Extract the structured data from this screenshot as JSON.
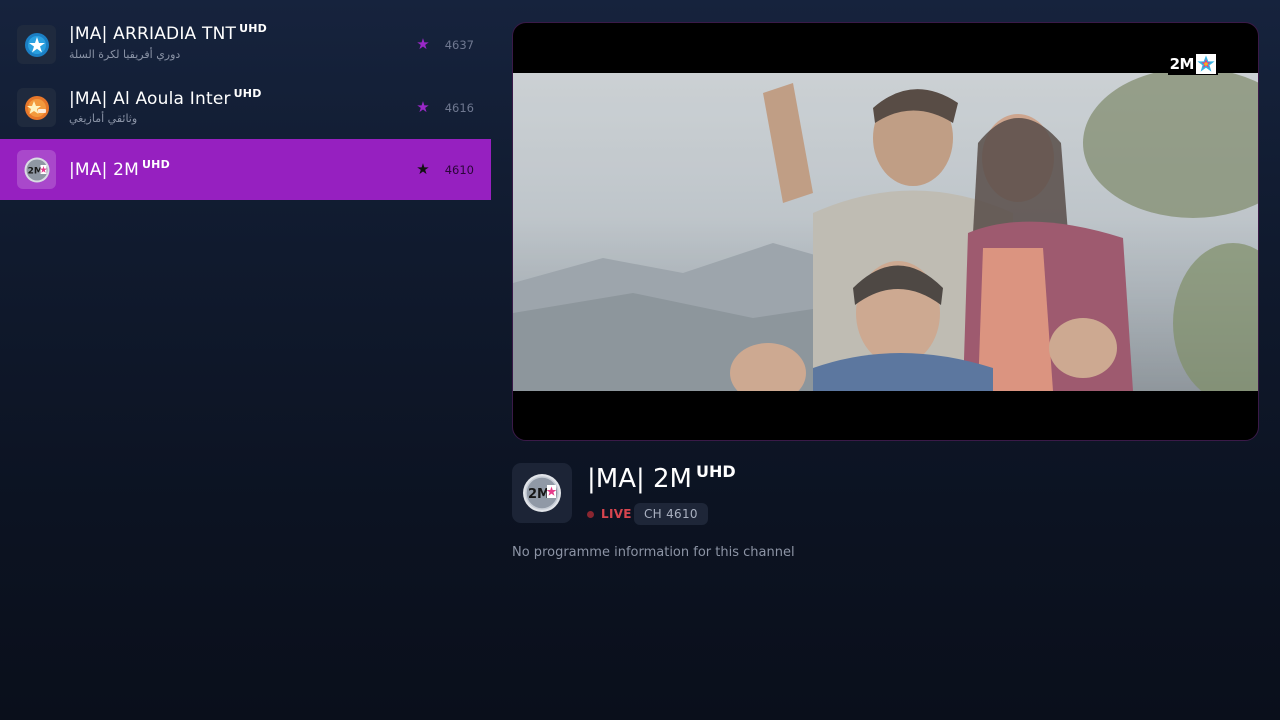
{
  "channels": [
    {
      "name": "|MA| ARRIADIA TNT",
      "badge": "UHD",
      "subtitle": "دوري أفريقيا لكرة السلة",
      "number": "4637",
      "logo_icon": "arriadia-logo-icon",
      "favorite": true
    },
    {
      "name": "|MA| Al Aoula Inter",
      "badge": "UHD",
      "subtitle": "وثائقي أمازيغي",
      "number": "4616",
      "logo_icon": "al-aoula-logo-icon",
      "favorite": true
    },
    {
      "name": "|MA| 2M",
      "badge": "UHD",
      "number": "4610",
      "logo_icon": "2m-logo-icon",
      "favorite": true,
      "selected": true
    }
  ],
  "player": {
    "channel_bug": "2M",
    "bug_icon": "2m-star-icon"
  },
  "info": {
    "title": "|MA| 2M",
    "badge": "UHD",
    "live_label": "LIVE",
    "channel_chip": "CH 4610",
    "epg_message": "No programme information for this channel"
  },
  "colors": {
    "selected_row": "#9620c0",
    "favorite_star": "#9a28c8",
    "live_red": "#d8454f",
    "background_top": "#16233d",
    "background_bottom": "#0a0f1b"
  }
}
